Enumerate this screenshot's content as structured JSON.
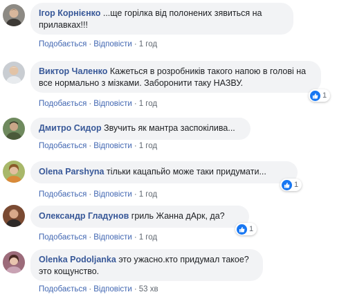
{
  "colors": {
    "author": "#385898",
    "link": "#4267b2",
    "meta": "#606770",
    "bubble": "#f2f3f5",
    "like": "#1877f2"
  },
  "comments": [
    {
      "author": "Ігор Корнієнко",
      "text": " ...ще горілка від полонених зявиться на прилавках!!!",
      "like_label": "Подобається",
      "reply_label": "Відповісти",
      "time": "1 год",
      "avatar_icon": "avatar-icon"
    },
    {
      "author": "Виктор Чаленко",
      "text": " Кажеться в розробників такого напою в голові на все нормально з мізками. Заборонити таку НАЗВУ.",
      "like_label": "Подобається",
      "reply_label": "Відповісти",
      "time": "1 год",
      "reaction_count": "1",
      "avatar_icon": "avatar-icon"
    },
    {
      "author": "Дмитро Сидор",
      "text": " Звучить як мантра заспокілива...",
      "like_label": "Подобається",
      "reply_label": "Відповісти",
      "time": "1 год",
      "avatar_icon": "avatar-icon"
    },
    {
      "author": "Olena Parshyna",
      "text": " тільки кацапьйо може таки придумати...",
      "like_label": "Подобається",
      "reply_label": "Відповісти",
      "time": "1 год",
      "reaction_count": "1",
      "avatar_icon": "avatar-icon"
    },
    {
      "author": "Олександр Гладунов",
      "text": " гриль Жанна дАрк, да?",
      "like_label": "Подобається",
      "reply_label": "Відповісти",
      "time": "1 год",
      "reaction_count": "1",
      "avatar_icon": "avatar-icon"
    },
    {
      "author": "Olenka Podoljanka",
      "text": " это ужасно.кто придумал такое?это кощунство.",
      "like_label": "Подобається",
      "reply_label": "Відповісти",
      "time": "53 хв",
      "avatar_icon": "avatar-icon"
    }
  ],
  "separator": "·"
}
